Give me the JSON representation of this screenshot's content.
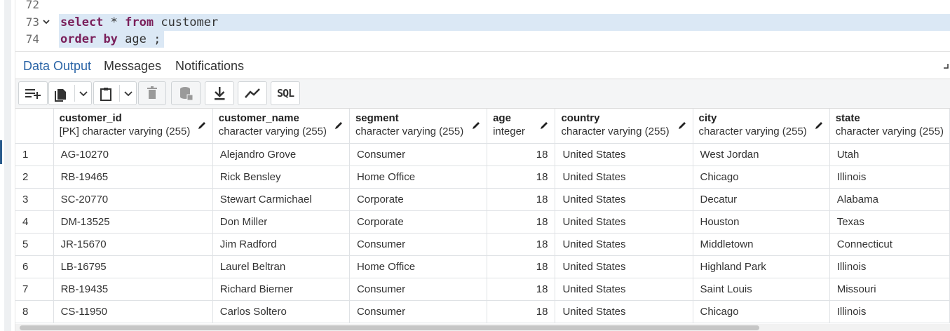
{
  "editor": {
    "lines": [
      {
        "number": "72",
        "parts": []
      },
      {
        "number": "73",
        "parts": [
          {
            "t": "select",
            "kw": true
          },
          {
            "t": " * ",
            "kw": false
          },
          {
            "t": "from",
            "kw": true
          },
          {
            "t": " customer",
            "kw": false
          }
        ]
      },
      {
        "number": "74",
        "parts": [
          {
            "t": "order",
            "kw": true
          },
          {
            "t": " ",
            "kw": false
          },
          {
            "t": "by",
            "kw": true
          },
          {
            "t": " age ;",
            "kw": false
          }
        ]
      }
    ],
    "fold_icon": "chevron-down-icon"
  },
  "tabs": {
    "data_output": "Data Output",
    "messages": "Messages",
    "notifications": "Notifications"
  },
  "toolbar": {
    "sql_label": "SQL"
  },
  "grid": {
    "columns": [
      {
        "name": "customer_id",
        "type": "[PK] character varying (255)",
        "align": "left"
      },
      {
        "name": "customer_name",
        "type": "character varying (255)",
        "align": "left"
      },
      {
        "name": "segment",
        "type": "character varying (255)",
        "align": "left"
      },
      {
        "name": "age",
        "type": "integer",
        "align": "right"
      },
      {
        "name": "country",
        "type": "character varying (255)",
        "align": "left"
      },
      {
        "name": "city",
        "type": "character varying (255)",
        "align": "left"
      },
      {
        "name": "state",
        "type": "character varying (255)",
        "align": "left"
      }
    ],
    "rows": [
      [
        "1",
        "AG-10270",
        "Alejandro Grove",
        "Consumer",
        "18",
        "United States",
        "West Jordan",
        "Utah"
      ],
      [
        "2",
        "RB-19465",
        "Rick Bensley",
        "Home Office",
        "18",
        "United States",
        "Chicago",
        "Illinois"
      ],
      [
        "3",
        "SC-20770",
        "Stewart Carmichael",
        "Corporate",
        "18",
        "United States",
        "Decatur",
        "Alabama"
      ],
      [
        "4",
        "DM-13525",
        "Don Miller",
        "Corporate",
        "18",
        "United States",
        "Houston",
        "Texas"
      ],
      [
        "5",
        "JR-15670",
        "Jim Radford",
        "Consumer",
        "18",
        "United States",
        "Middletown",
        "Connecticut"
      ],
      [
        "6",
        "LB-16795",
        "Laurel Beltran",
        "Home Office",
        "18",
        "United States",
        "Highland Park",
        "Illinois"
      ],
      [
        "7",
        "RB-19435",
        "Richard Bierner",
        "Consumer",
        "18",
        "United States",
        "Saint Louis",
        "Missouri"
      ],
      [
        "8",
        "CS-11950",
        "Carlos Soltero",
        "Consumer",
        "18",
        "United States",
        "Chicago",
        "Illinois"
      ]
    ]
  },
  "colors": {
    "accent": "#2a64a6",
    "keyword": "#7a1f5a",
    "selection": "#dbe8f5"
  }
}
